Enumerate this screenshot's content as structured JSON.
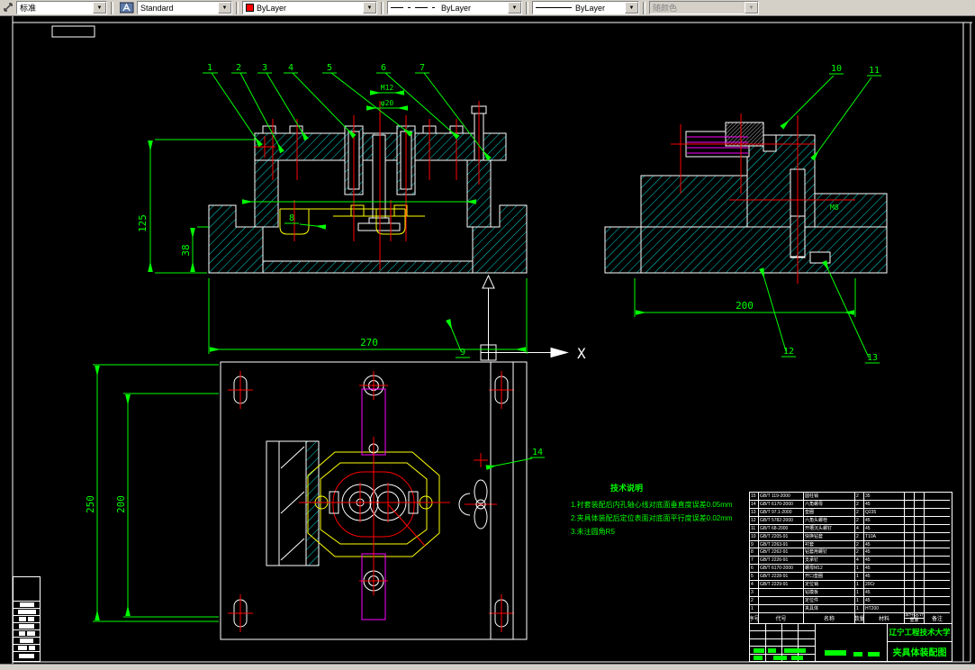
{
  "toolbar": {
    "dim_style": {
      "value": "标准"
    },
    "text_style": {
      "value": "Standard"
    },
    "color": {
      "value": "ByLayer",
      "swatch": "#ff0000"
    },
    "linetype": {
      "value": "ByLayer"
    },
    "lineweight": {
      "value": "ByLayer"
    },
    "plot_style": {
      "value": "随颜色"
    },
    "dropdown_glyph": "▼"
  },
  "canvas": {
    "axis_label": "X",
    "colors": {
      "background": "#000000",
      "outline": "#ffffff",
      "hatch": "#00d9d9",
      "dimension": "#00ff00",
      "centerline": "#ff0000",
      "workpiece": "#ffff00",
      "slot": "#ff00ff"
    },
    "dimensions": {
      "front_height": "125",
      "front_base_height": "38",
      "front_width": "270",
      "plan_outer": "250",
      "plan_inner": "200",
      "side_width": "200",
      "detail_top": "M12",
      "detail_bottom": "φ20",
      "side_thread": "M8"
    },
    "balloons": [
      "1",
      "2",
      "3",
      "4",
      "5",
      "6",
      "7",
      "8",
      "9",
      "10",
      "11",
      "12",
      "13",
      "14"
    ],
    "notes": {
      "title": "技术说明",
      "line1": "1.衬套装配后内孔轴心线对底面垂直度误差0.05mm",
      "line2": "2.夹具体装配后定位表面对底面平行度误差0.02mm",
      "line3": "3.未注圆角R5"
    }
  },
  "title_block": {
    "university": "辽宁工程技术大学",
    "drawing_title": "夹具体装配图",
    "headers": {
      "no": "序号",
      "code": "代号",
      "name": "名称",
      "qty": "数量",
      "material": "材料",
      "unit": "单件",
      "total": "总计",
      "weight": "重量",
      "remark": "备注"
    },
    "rows": [
      {
        "no": "15",
        "code": "GB/T 119-2000",
        "name": "圆柱销",
        "qty": "2",
        "material": "35"
      },
      {
        "no": "14",
        "code": "GB/T 6170-2000",
        "name": "六角螺母",
        "qty": "2",
        "material": "45"
      },
      {
        "no": "13",
        "code": "GB/T 97.1-2000",
        "name": "垫圈",
        "qty": "2",
        "material": "Q235"
      },
      {
        "no": "12",
        "code": "GB/T 5782-2000",
        "name": "六角头螺栓",
        "qty": "2",
        "material": "45"
      },
      {
        "no": "11",
        "code": "GB/T 68-2000",
        "name": "开槽沉头螺钉",
        "qty": "4",
        "material": "45"
      },
      {
        "no": "10",
        "code": "GB/T 2205-91",
        "name": "快换钻套",
        "qty": "2",
        "material": "T10A"
      },
      {
        "no": "9",
        "code": "GB/T 2263-91",
        "name": "衬套",
        "qty": "2",
        "material": "45"
      },
      {
        "no": "8",
        "code": "GB/T 2262-91",
        "name": "钻套用螺钉",
        "qty": "2",
        "material": "45"
      },
      {
        "no": "7",
        "code": "GB/T 2226-91",
        "name": "支承钉",
        "qty": "4",
        "material": "45"
      },
      {
        "no": "6",
        "code": "GB/T 6170-2000",
        "name": "螺母M12",
        "qty": "1",
        "material": "45"
      },
      {
        "no": "5",
        "code": "GB/T 2228-91",
        "name": "开口垫圈",
        "qty": "1",
        "material": "45"
      },
      {
        "no": "4",
        "code": "GB/T 2229-91",
        "name": "定位销",
        "qty": "1",
        "material": "20Cr"
      },
      {
        "no": "3",
        "code": "",
        "name": "钻模板",
        "qty": "1",
        "material": "45"
      },
      {
        "no": "2",
        "code": "",
        "name": "定位件",
        "qty": "1",
        "material": "45"
      },
      {
        "no": "1",
        "code": "",
        "name": "夹具体",
        "qty": "1",
        "material": "HT200"
      }
    ]
  }
}
